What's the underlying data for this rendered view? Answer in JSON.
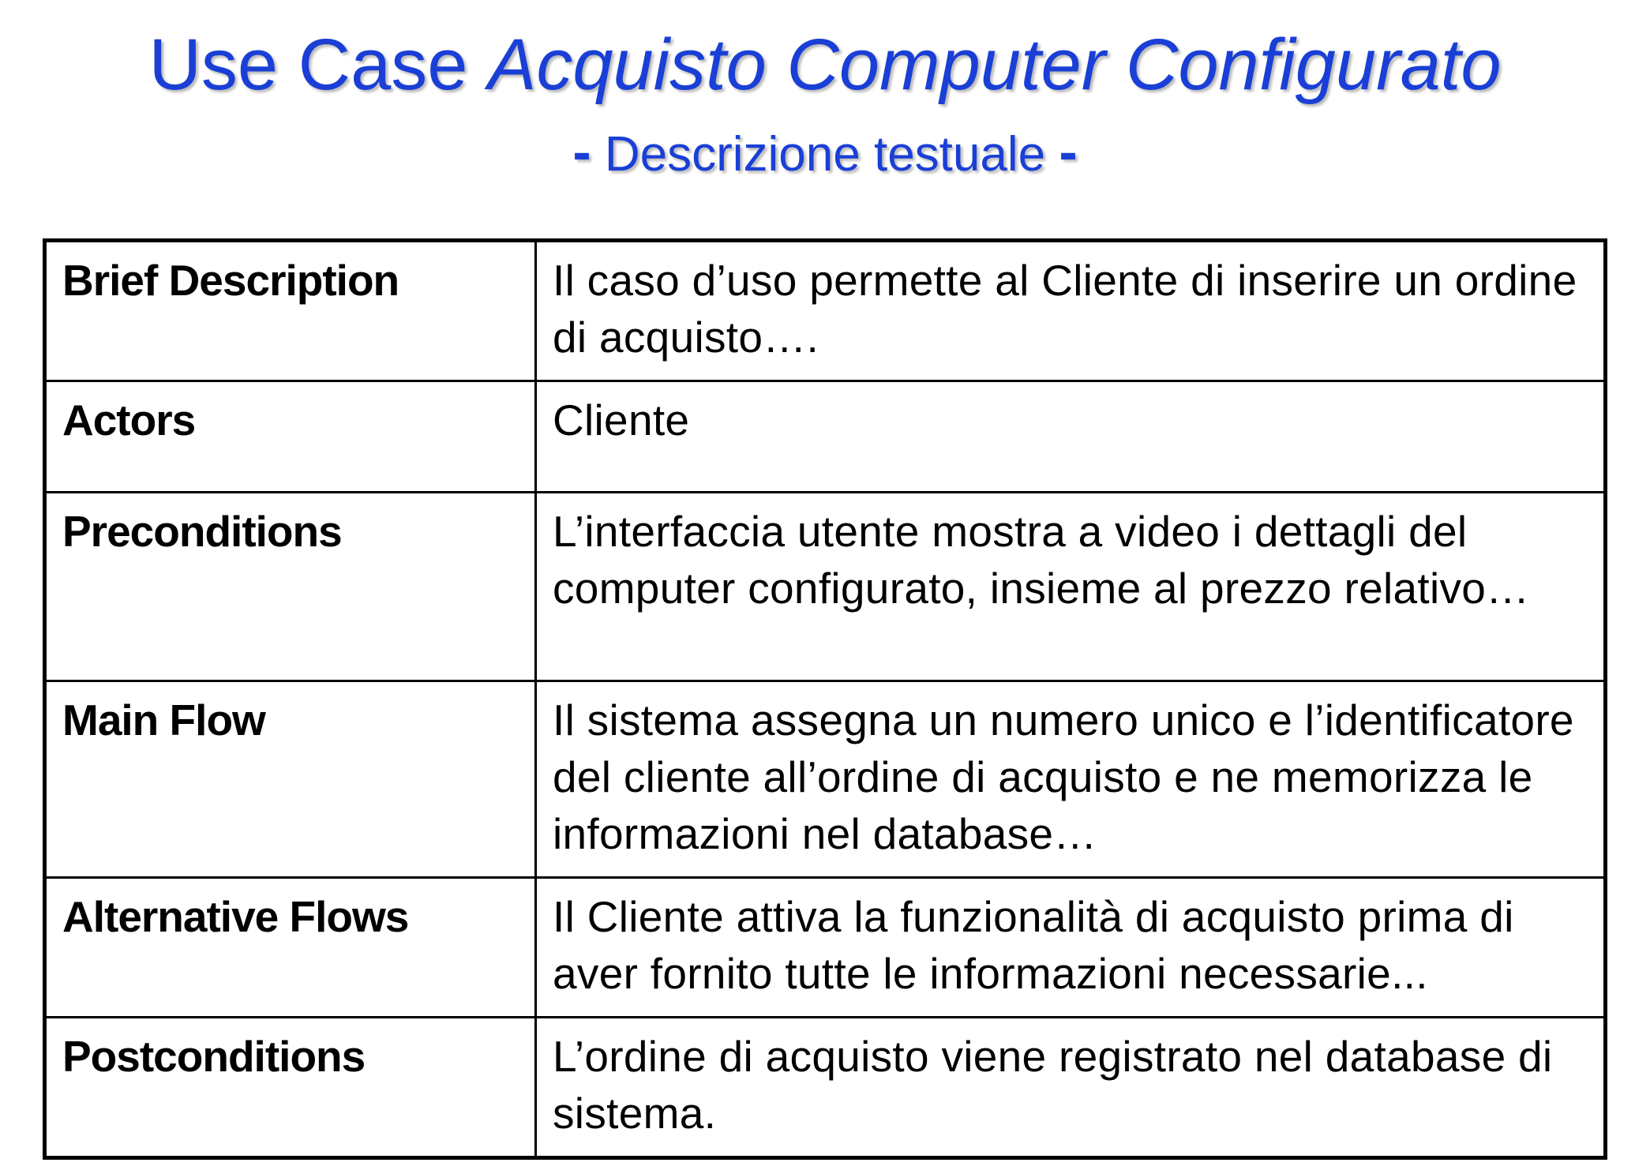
{
  "slide": {
    "title": {
      "prefix": "Use Case ",
      "italic": "Acquisto Computer Configurato"
    },
    "subtitle": {
      "dash_left": "-",
      "text": " Descrizione testuale ",
      "dash_right": "-"
    }
  },
  "table": {
    "rows": [
      {
        "label": "Brief Description",
        "value": "Il caso d’uso permette al Cliente di inserire un ordine di acquisto…."
      },
      {
        "label": "Actors",
        "value": "Cliente"
      },
      {
        "label": "Preconditions",
        "value": "L’interfaccia utente mostra a video i dettagli del computer configurato, insieme al prezzo relativo…"
      },
      {
        "label": "Main Flow",
        "value": "Il sistema assegna un numero unico e l’identificatore del cliente all’ordine di acquisto e ne memorizza le informazioni nel database…"
      },
      {
        "label": "Alternative Flows",
        "value": "Il Cliente attiva la funzionalità di acquisto prima di aver fornito tutte le informazioni necessarie..."
      },
      {
        "label": "Postconditions",
        "value": "L’ordine di acquisto viene registrato nel database di sistema."
      }
    ]
  },
  "colors": {
    "title": "#1a3fd6",
    "text": "#000000",
    "border": "#000000",
    "background": "#ffffff"
  }
}
